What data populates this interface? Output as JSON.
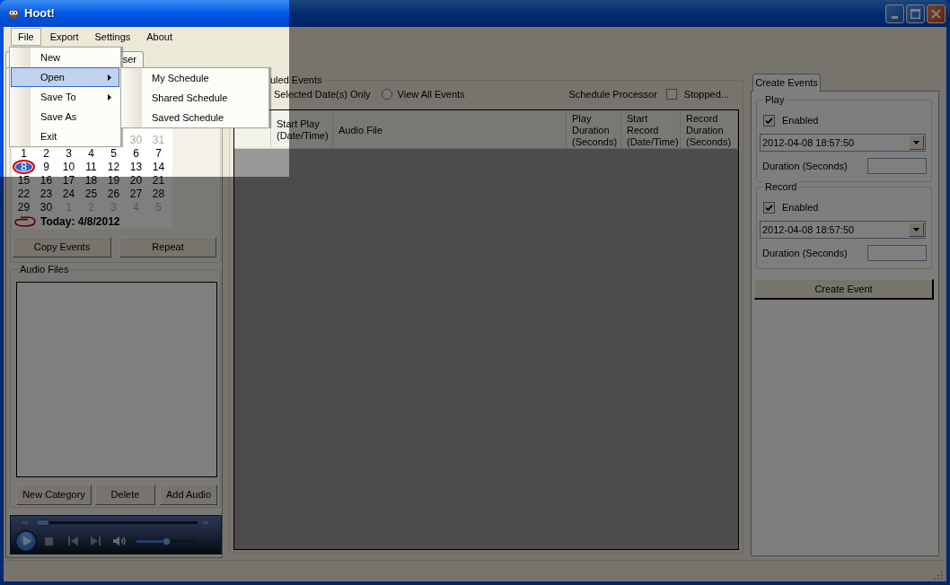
{
  "window": {
    "title": "Hoot!"
  },
  "menu_bar": [
    {
      "label": "File",
      "selected": true
    },
    {
      "label": "Export",
      "selected": false
    },
    {
      "label": "Settings",
      "selected": false
    },
    {
      "label": "About",
      "selected": false
    }
  ],
  "file_menu": [
    {
      "label": "New",
      "selected": false,
      "submenu": false
    },
    {
      "label": "Open",
      "selected": true,
      "submenu": true
    },
    {
      "label": "Save To",
      "selected": false,
      "submenu": true
    },
    {
      "label": "Save As",
      "selected": false,
      "submenu": false
    },
    {
      "label": "Exit",
      "selected": false,
      "submenu": false
    }
  ],
  "open_submenu": [
    {
      "label": "My Schedule",
      "selected": false
    },
    {
      "label": "Shared Schedule",
      "selected": false
    },
    {
      "label": "Saved Schedule",
      "selected": false
    }
  ],
  "left_tabs": [
    {
      "label": "ser"
    }
  ],
  "calendar": {
    "weeks": [
      [
        {
          "day": "30",
          "muted": true,
          "selected": false,
          "today": false
        },
        {
          "day": "31",
          "muted": true,
          "selected": false,
          "today": false
        }
      ],
      [
        {
          "day": "1",
          "muted": false,
          "selected": false,
          "today": false
        },
        {
          "day": "2",
          "muted": false,
          "selected": false,
          "today": false
        },
        {
          "day": "3",
          "muted": false,
          "selected": false,
          "today": false
        },
        {
          "day": "4",
          "muted": false,
          "selected": false,
          "today": false
        },
        {
          "day": "5",
          "muted": false,
          "selected": false,
          "today": false
        },
        {
          "day": "6",
          "muted": false,
          "selected": false,
          "today": false
        },
        {
          "day": "7",
          "muted": false,
          "selected": false,
          "today": false
        }
      ],
      [
        {
          "day": "8",
          "muted": false,
          "selected": true,
          "today": true
        },
        {
          "day": "9",
          "muted": false,
          "selected": false,
          "today": false
        },
        {
          "day": "10",
          "muted": false,
          "selected": false,
          "today": false
        },
        {
          "day": "11",
          "muted": false,
          "selected": false,
          "today": false
        },
        {
          "day": "12",
          "muted": false,
          "selected": false,
          "today": false
        },
        {
          "day": "13",
          "muted": false,
          "selected": false,
          "today": false
        },
        {
          "day": "14",
          "muted": false,
          "selected": false,
          "today": false
        }
      ],
      [
        {
          "day": "15",
          "muted": false,
          "selected": false,
          "today": false
        },
        {
          "day": "16",
          "muted": false,
          "selected": false,
          "today": false
        },
        {
          "day": "17",
          "muted": false,
          "selected": false,
          "today": false
        },
        {
          "day": "18",
          "muted": false,
          "selected": false,
          "today": false
        },
        {
          "day": "19",
          "muted": false,
          "selected": false,
          "today": false
        },
        {
          "day": "20",
          "muted": false,
          "selected": false,
          "today": false
        },
        {
          "day": "21",
          "muted": false,
          "selected": false,
          "today": false
        }
      ],
      [
        {
          "day": "22",
          "muted": false,
          "selected": false,
          "today": false
        },
        {
          "day": "23",
          "muted": false,
          "selected": false,
          "today": false
        },
        {
          "day": "24",
          "muted": false,
          "selected": false,
          "today": false
        },
        {
          "day": "25",
          "muted": false,
          "selected": false,
          "today": false
        },
        {
          "day": "26",
          "muted": false,
          "selected": false,
          "today": false
        },
        {
          "day": "27",
          "muted": false,
          "selected": false,
          "today": false
        },
        {
          "day": "28",
          "muted": false,
          "selected": false,
          "today": false
        }
      ],
      [
        {
          "day": "29",
          "muted": false,
          "selected": false,
          "today": false
        },
        {
          "day": "30",
          "muted": false,
          "selected": false,
          "today": false
        },
        {
          "day": "1",
          "muted": true,
          "selected": false,
          "today": false
        },
        {
          "day": "2",
          "muted": true,
          "selected": false,
          "today": false
        },
        {
          "day": "3",
          "muted": true,
          "selected": false,
          "today": false
        },
        {
          "day": "4",
          "muted": true,
          "selected": false,
          "today": false
        },
        {
          "day": "5",
          "muted": true,
          "selected": false,
          "today": false
        }
      ]
    ],
    "today_label": "Today: 4/8/2012"
  },
  "calendar_buttons": [
    "Copy Events",
    "Repeat"
  ],
  "audio_files": {
    "title": "Audio Files",
    "buttons": [
      "New Category",
      "Delete",
      "Add Audio"
    ]
  },
  "media_player": {
    "seek": {
      "level": 0
    },
    "volume": {
      "level": 0.5
    }
  },
  "scheduled_events": {
    "title": "uled Events",
    "show_selected_label": "Selected Date(s) Only",
    "view_all": {
      "label": "View All Events",
      "selected": false
    },
    "processor_label": "Schedule Processor",
    "processor": {
      "label": "Stopped...",
      "checked": false
    },
    "columns": [
      "Start Play\n(Date/Time)",
      "Audio File",
      "Play\nDuration\n(Seconds)",
      "Start\nRecord\n(Date/Time)",
      "Record\nDuration\n(Seconds)"
    ]
  },
  "create_events": {
    "tab": {
      "label": "Create Events",
      "selected": true
    },
    "sections": [
      {
        "title": "Play",
        "enabled": {
          "label": "Enabled",
          "checked": true
        },
        "datetime": "2012-04-08 18:57:50",
        "duration_label": "Duration (Seconds)"
      },
      {
        "title": "Record",
        "enabled": {
          "label": "Enabled",
          "checked": true
        },
        "datetime": "2012-04-08 18:57:50",
        "duration_label": "Duration (Seconds)"
      }
    ],
    "button": "Create Event"
  }
}
